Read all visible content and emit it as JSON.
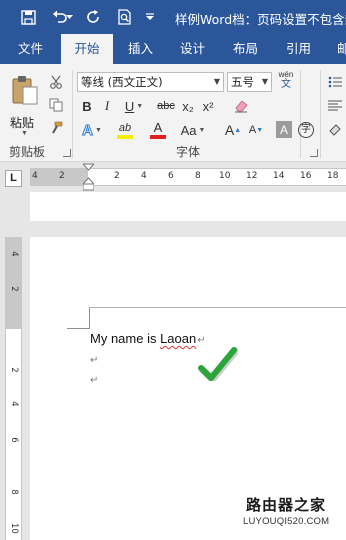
{
  "window": {
    "title": "样例Word档：页码设置不包含封"
  },
  "tabs": [
    {
      "label": "文件",
      "active": false
    },
    {
      "label": "开始",
      "active": true
    },
    {
      "label": "插入",
      "active": false
    },
    {
      "label": "设计",
      "active": false
    },
    {
      "label": "布局",
      "active": false
    },
    {
      "label": "引用",
      "active": false
    },
    {
      "label": "邮",
      "active": false
    }
  ],
  "ribbon": {
    "clipboard": {
      "paste_label": "粘贴",
      "group_label": "剪贴板"
    },
    "font": {
      "font_name": "等线 (西文正文)",
      "font_size": "五号",
      "wen_top": "wén",
      "wen_bottom": "文",
      "bold": "B",
      "italic": "I",
      "underline": "U",
      "strike": "abc",
      "subscript": "x₂",
      "superscript": "x²",
      "text_effects": "A",
      "highlight": "ab",
      "font_color": "A",
      "change_case": "Aa",
      "grow": "A",
      "shrink": "A",
      "char_shading": "A",
      "enclose": "字",
      "group_label": "字体"
    },
    "accent_colors": {
      "highlight": "#f5f000",
      "font_color": "#e02020",
      "brand": "#2b579a"
    }
  },
  "ruler": {
    "corner": "L",
    "ticks": [
      "4",
      "2",
      "2",
      "4",
      "6",
      "8",
      "10",
      "12",
      "14",
      "16",
      "18"
    ],
    "vticks": [
      "4",
      "2",
      "2",
      "4",
      "6",
      "8",
      "10"
    ]
  },
  "document": {
    "line1_prefix": "My name is ",
    "line1_misspelled": "Laoan",
    "para_mark": "↵"
  },
  "watermark": {
    "name": "路由器之家",
    "url": "LUYOUQI520.COM"
  }
}
